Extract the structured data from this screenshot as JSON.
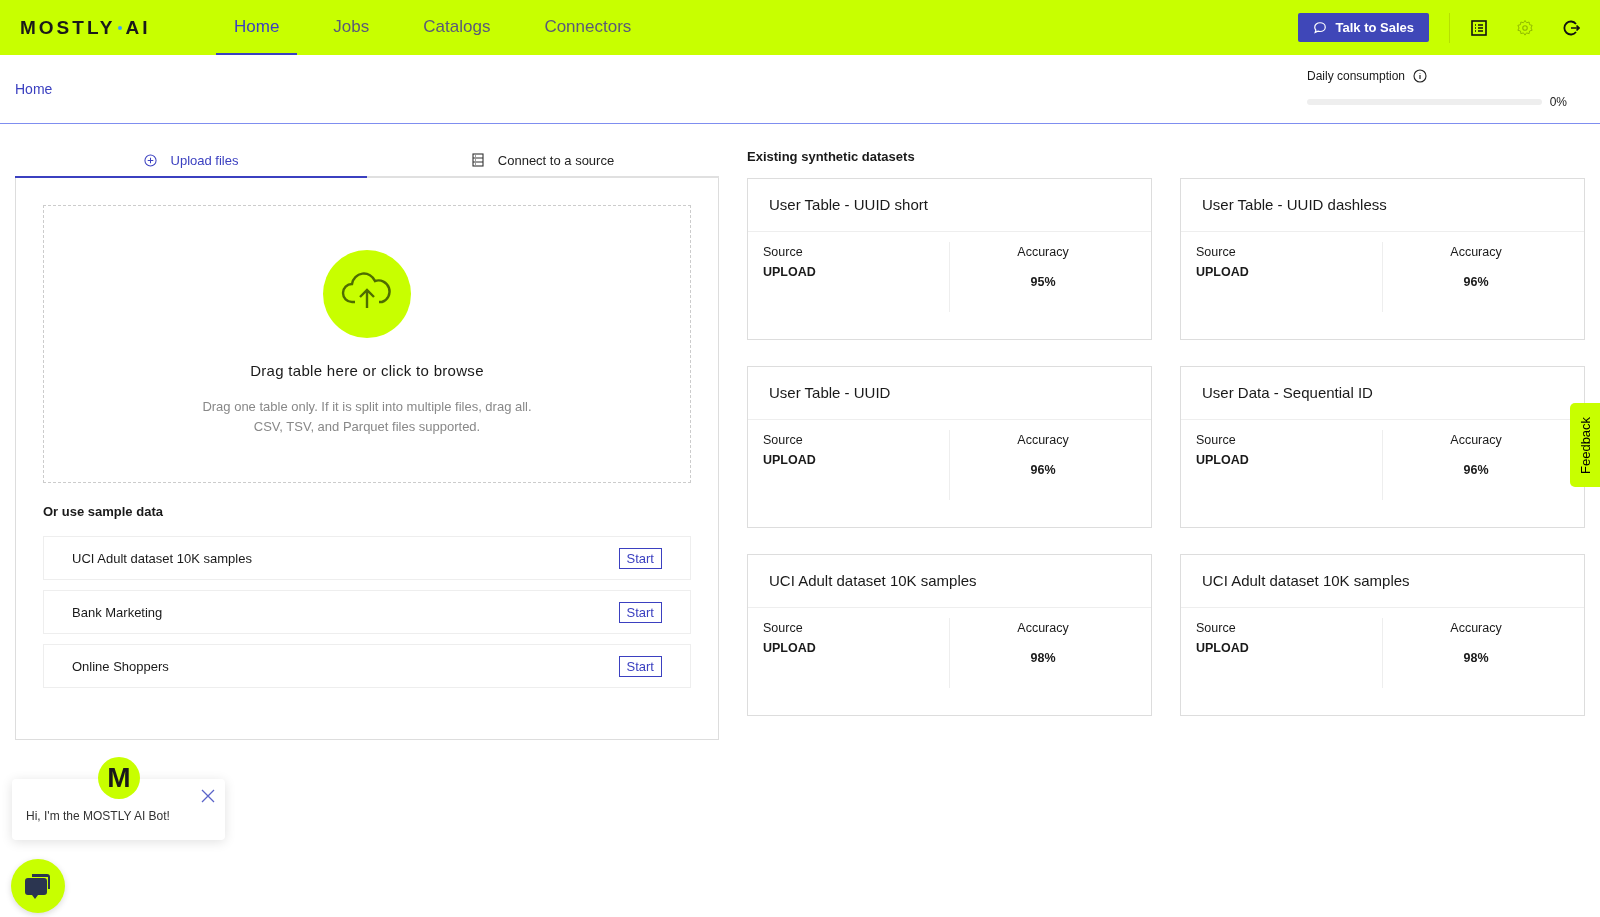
{
  "header": {
    "logo": [
      "MOSTLY",
      "AI"
    ],
    "nav": [
      {
        "label": "Home",
        "selected": true
      },
      {
        "label": "Jobs",
        "selected": false
      },
      {
        "label": "Catalogs",
        "selected": false
      },
      {
        "label": "Connectors",
        "selected": false
      }
    ],
    "talk_button": "Talk to Sales"
  },
  "breadcrumb": "Home",
  "consumption": {
    "label": "Daily consumption",
    "level": 0,
    "reading": "0%"
  },
  "tabs": [
    {
      "label": "Upload files",
      "kind": "upload",
      "selected": true
    },
    {
      "label": "Connect to a source",
      "kind": "source",
      "selected": false
    }
  ],
  "dropzone": {
    "title": "Drag table here or click to browse",
    "hint": [
      "Drag one table only. If it is split into multiple files, drag all.",
      "CSV, TSV, and Parquet files supported."
    ]
  },
  "samples": {
    "title": "Or use sample data",
    "items": [
      {
        "name": "UCI Adult dataset 10K samples",
        "action": "Start"
      },
      {
        "name": "Bank Marketing",
        "action": "Start"
      },
      {
        "name": "Online Shoppers",
        "action": "Start"
      }
    ]
  },
  "datasets": {
    "title": "Existing synthetic datasets",
    "items": [
      {
        "name": "User Table - UUID short",
        "source_label": "Source",
        "source": "UPLOAD",
        "accuracy_label": "Accuracy",
        "accuracy": "95%"
      },
      {
        "name": "User Table - UUID dashless",
        "source_label": "Source",
        "source": "UPLOAD",
        "accuracy_label": "Accuracy",
        "accuracy": "96%"
      },
      {
        "name": "User Table - UUID",
        "source_label": "Source",
        "source": "UPLOAD",
        "accuracy_label": "Accuracy",
        "accuracy": "96%"
      },
      {
        "name": "User Data - Sequential ID",
        "source_label": "Source",
        "source": "UPLOAD",
        "accuracy_label": "Accuracy",
        "accuracy": "96%"
      },
      {
        "name": "UCI Adult dataset 10K samples",
        "source_label": "Source",
        "source": "UPLOAD",
        "accuracy_label": "Accuracy",
        "accuracy": "98%"
      },
      {
        "name": "UCI Adult dataset 10K samples",
        "source_label": "Source",
        "source": "UPLOAD",
        "accuracy_label": "Accuracy",
        "accuracy": "98%"
      }
    ]
  },
  "feedback": "Feedback",
  "chatbot": {
    "avatar": "M",
    "message": "Hi, I'm the MOSTLY AI Bot!"
  }
}
